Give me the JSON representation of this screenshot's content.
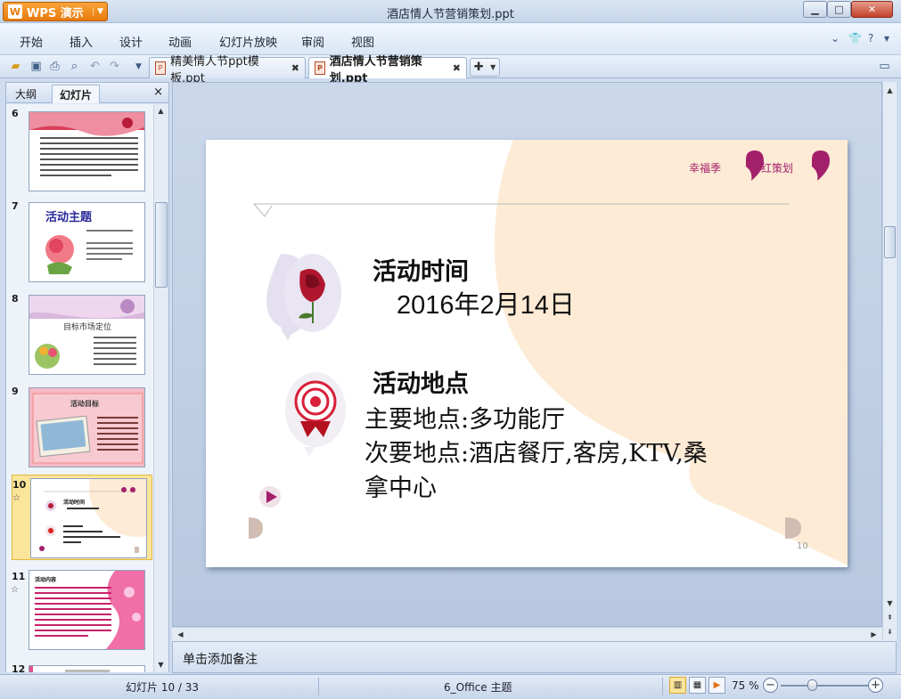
{
  "window": {
    "app_button": "WPS 演示",
    "title": "酒店情人节营销策划.ppt",
    "controls": {
      "minimize": "▁",
      "maximize": "□",
      "close": "✕"
    }
  },
  "menu": {
    "items": [
      "开始",
      "插入",
      "设计",
      "动画",
      "幻灯片放映",
      "审阅",
      "视图"
    ]
  },
  "tabs": [
    {
      "label": "精美情人节ppt模板.ppt",
      "active": false
    },
    {
      "label": "酒店情人节营销策划.ppt",
      "active": true
    }
  ],
  "left_pane": {
    "tab_outline": "大纲",
    "tab_slides": "幻灯片",
    "close": "×",
    "thumbnails": [
      {
        "num": "6",
        "star": ""
      },
      {
        "num": "7",
        "star": "",
        "title": "活动主题"
      },
      {
        "num": "8",
        "star": "",
        "title": "目标市场定位"
      },
      {
        "num": "9",
        "star": "",
        "title": "活动目标"
      },
      {
        "num": "10",
        "star": "☆",
        "title": "活动时间"
      },
      {
        "num": "11",
        "star": "☆",
        "title": "活动内容"
      },
      {
        "num": "12",
        "star": ""
      }
    ]
  },
  "slide": {
    "tag_left": "幸福季",
    "tag_right": "红策划",
    "heading_time": "活动时间",
    "date": "2016年2月14日",
    "heading_place": "活动地点",
    "main_place": "主要地点:多功能厅",
    "secondary_place_line1": "次要地点:酒店餐厅,客房,KTV,桑",
    "secondary_place_line2": "拿中心",
    "page_number": "10",
    "colors": {
      "accent": "#a3206a",
      "peach": "#fdebd6",
      "tan": "#d1bdb2"
    }
  },
  "notes": {
    "placeholder": "单击添加备注"
  },
  "status": {
    "slide_counter": "幻灯片 10 / 33",
    "theme": "6_Office 主题",
    "zoom": "75 %"
  }
}
